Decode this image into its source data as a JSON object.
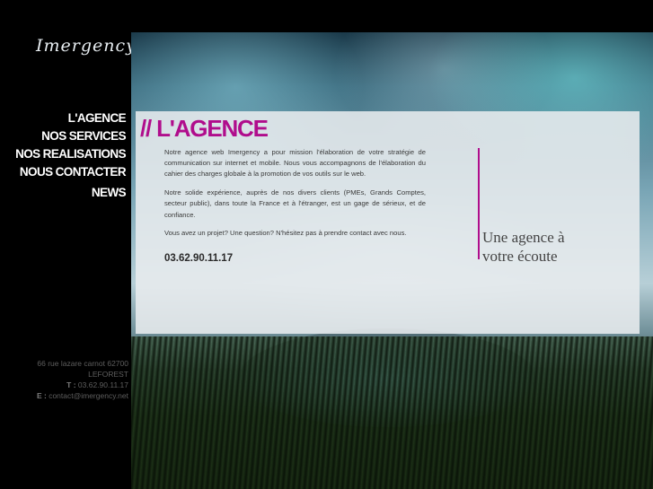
{
  "brand": {
    "logo_text": "Imergency"
  },
  "nav": {
    "items": [
      {
        "label": "L'AGENCE"
      },
      {
        "label": "NOS SERVICES"
      },
      {
        "label": "NOS REALISATIONS"
      },
      {
        "label": "NOUS CONTACTER"
      },
      {
        "label": "NEWS"
      }
    ]
  },
  "address": {
    "line1": "66 rue lazare carnot 62700 LEFOREST",
    "phone_prefix": "T :",
    "phone": "03.62.90.11.17",
    "email_prefix": "E :",
    "email": "contact@imergency.net"
  },
  "content": {
    "title": "// L'AGENCE",
    "paragraphs": [
      "Notre agence web Imergency a pour mission l'élaboration de votre stratégie de communication sur internet et mobile. Nous vous accompagnons de l'élaboration du cahier des charges globale à la promotion de vos outils sur le web.",
      "Notre solide expérience, auprès de nos divers clients (PMEs, Grands Comptes, secteur public), dans toute la France et à l'étranger, est un gage de sérieux, et de confiance.",
      "Vous avez un projet? Une question? N'hésitez pas à prendre contact avec nous."
    ],
    "phone": "03.62.90.11.17",
    "tagline_line1": "Une agence à",
    "tagline_line2": "votre écoute"
  },
  "colors": {
    "accent": "#b00d8c",
    "background": "#000000",
    "panel": "#e8ecee"
  }
}
